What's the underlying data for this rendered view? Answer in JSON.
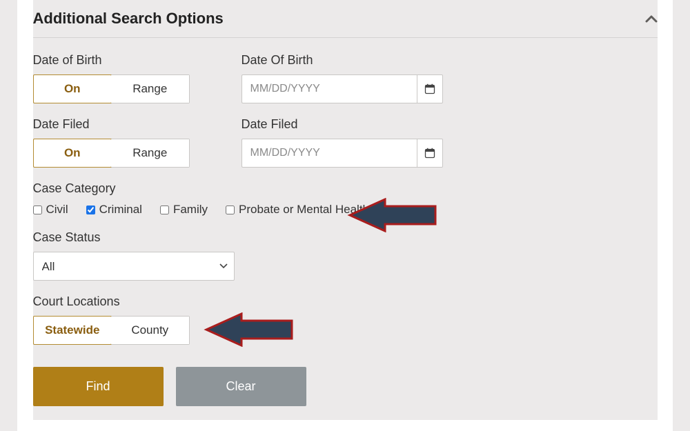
{
  "header": {
    "title": "Additional Search Options"
  },
  "dob": {
    "label_toggle": "Date of Birth",
    "label_input": "Date Of Birth",
    "on": "On",
    "range": "Range",
    "placeholder": "MM/DD/YYYY"
  },
  "filed": {
    "label_toggle": "Date Filed",
    "label_input": "Date Filed",
    "on": "On",
    "range": "Range",
    "placeholder": "MM/DD/YYYY"
  },
  "category": {
    "label": "Case Category",
    "civil": "Civil",
    "criminal": "Criminal",
    "family": "Family",
    "probate": "Probate or Mental Health"
  },
  "status": {
    "label": "Case Status",
    "selected": "All"
  },
  "locations": {
    "label": "Court Locations",
    "statewide": "Statewide",
    "county": "County"
  },
  "buttons": {
    "find": "Find",
    "clear": "Clear"
  },
  "colors": {
    "accent": "#b07f17",
    "arrow_fill": "#2f4258",
    "arrow_stroke": "#a91d1d"
  }
}
